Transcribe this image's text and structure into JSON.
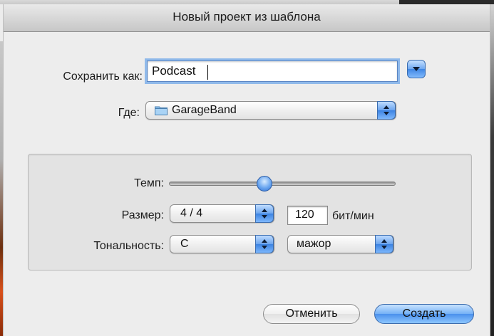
{
  "dialog": {
    "title": "Новый проект из шаблона",
    "save_as_label": "Сохранить как:",
    "save_as_value": "Podcast",
    "where_label": "Где:",
    "where_value": "GarageBand",
    "tempo_label": "Темп:",
    "tempo_level": 0.42,
    "size_label": "Размер:",
    "size_value": "4 / 4",
    "bpm_value": "120",
    "bpm_unit": "бит/мин",
    "key_label": "Тональность:",
    "key_value": "C",
    "mode_value": "мажор",
    "cancel_label": "Отменить",
    "create_label": "Создать"
  },
  "colors": {
    "accent": "#4a90ec",
    "window_bg": "#ededed"
  },
  "icons": {
    "disclosure": "chevron-down-icon",
    "folder": "folder-icon",
    "stepper": "up-down-arrows-icon"
  }
}
